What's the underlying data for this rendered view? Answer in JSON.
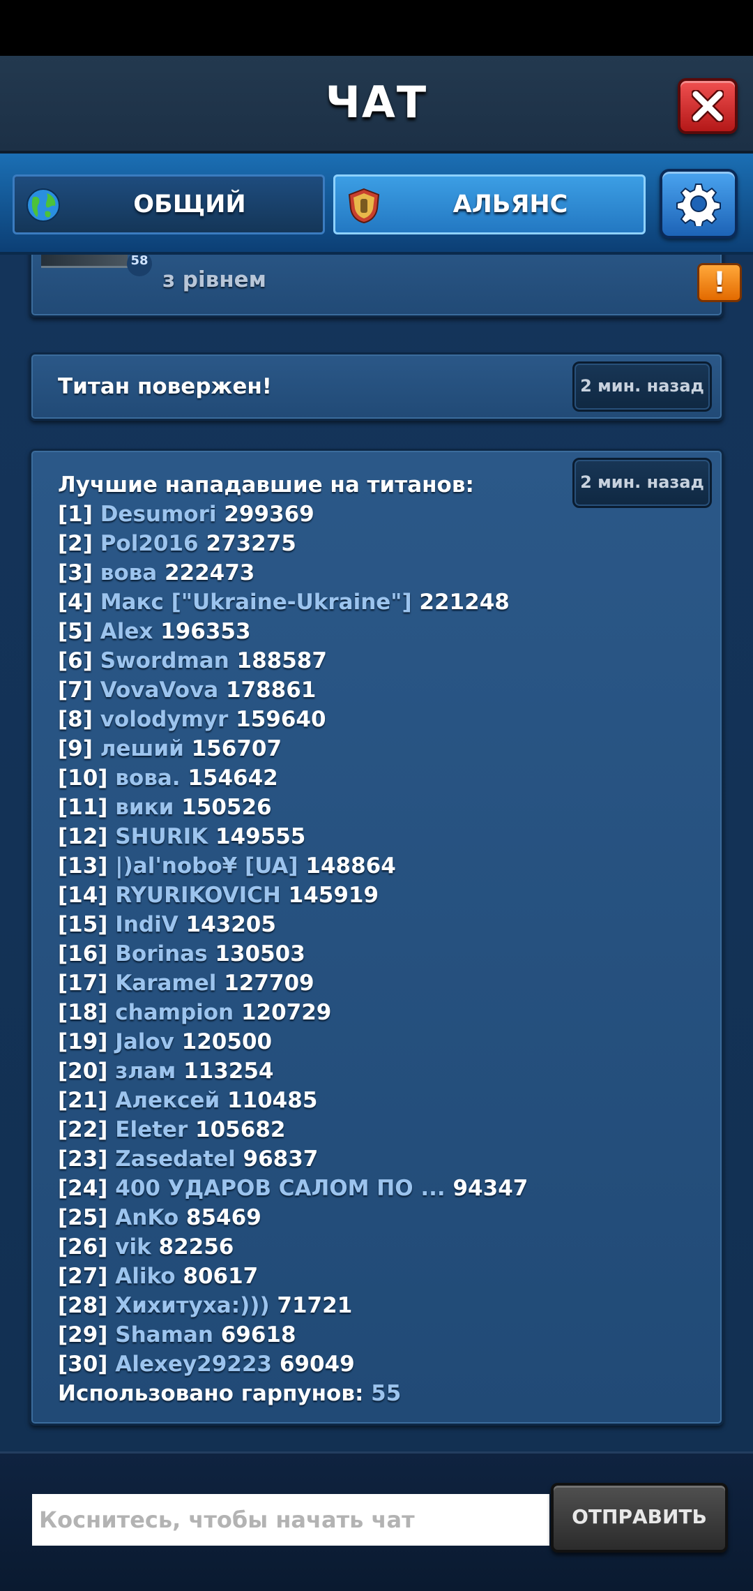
{
  "header": {
    "title": "ЧАТ"
  },
  "tabs": [
    {
      "label": "ОБЩИЙ",
      "icon": "globe-icon",
      "active": false
    },
    {
      "label": "АЛЬЯНС",
      "icon": "shield-icon",
      "active": true
    }
  ],
  "partial_message": {
    "level": "58",
    "text": "з рівнем"
  },
  "messages": [
    {
      "text": "Титан повержен!",
      "time": "2 мин. назад"
    },
    {
      "text": "Лучшие нападавшие на титанов:",
      "time": "2 мин. назад"
    }
  ],
  "rankings": [
    {
      "rank": "[1]",
      "name": "Desumori",
      "score": "299369"
    },
    {
      "rank": "[2]",
      "name": "Pol2016",
      "score": "273275"
    },
    {
      "rank": "[3]",
      "name": "вова",
      "score": "222473"
    },
    {
      "rank": "[4]",
      "name": "Макс [\"Ukraine-Ukraine\"]",
      "score": "221248"
    },
    {
      "rank": "[5]",
      "name": "Alex",
      "score": "196353"
    },
    {
      "rank": "[6]",
      "name": "Swordman",
      "score": "188587"
    },
    {
      "rank": "[7]",
      "name": "VovaVova",
      "score": "178861"
    },
    {
      "rank": "[8]",
      "name": "volodymyr",
      "score": "159640"
    },
    {
      "rank": "[9]",
      "name": "леший",
      "score": "156707"
    },
    {
      "rank": "[10]",
      "name": "вова.",
      "score": "154642"
    },
    {
      "rank": "[11]",
      "name": "вики",
      "score": "150526"
    },
    {
      "rank": "[12]",
      "name": "SHURIK",
      "score": "149555"
    },
    {
      "rank": "[13]",
      "name": "|)al'nobo¥ [UA]",
      "score": "148864"
    },
    {
      "rank": "[14]",
      "name": "RYURIKOVICH",
      "score": "145919"
    },
    {
      "rank": "[15]",
      "name": "IndiV",
      "score": "143205"
    },
    {
      "rank": "[16]",
      "name": "Borinas",
      "score": "130503"
    },
    {
      "rank": "[17]",
      "name": "Karamel",
      "score": "127709"
    },
    {
      "rank": "[18]",
      "name": "champion",
      "score": "120729"
    },
    {
      "rank": "[19]",
      "name": "Jalov",
      "score": "120500"
    },
    {
      "rank": "[20]",
      "name": "злам",
      "score": "113254"
    },
    {
      "rank": "[21]",
      "name": "Алексей",
      "score": "110485"
    },
    {
      "rank": "[22]",
      "name": "Eleter",
      "score": "105682"
    },
    {
      "rank": "[23]",
      "name": "Zasedatel",
      "score": "96837"
    },
    {
      "rank": "[24]",
      "name": "400 УДАРОВ САЛОМ ПО ...",
      "score": "94347"
    },
    {
      "rank": "[25]",
      "name": "AnKo",
      "score": "85469"
    },
    {
      "rank": "[26]",
      "name": "vik",
      "score": "82256"
    },
    {
      "rank": "[27]",
      "name": "Aliko",
      "score": "80617"
    },
    {
      "rank": "[28]",
      "name": "Хихитуха:)))",
      "score": "71721"
    },
    {
      "rank": "[29]",
      "name": "Shaman",
      "score": "69618"
    },
    {
      "rank": "[30]",
      "name": "Alexey29223",
      "score": "69049"
    }
  ],
  "summary": {
    "label": "Использовано гарпунов:",
    "value": "55"
  },
  "input": {
    "placeholder": "Коснитесь, чтобы начать чат",
    "value": ""
  },
  "send_label": "ОТПРАВИТЬ",
  "colors": {
    "name_link": "#9cc4ee",
    "accent_tab": "#2378c2",
    "close_red": "#d42a2a",
    "warn_orange": "#f08a10"
  }
}
